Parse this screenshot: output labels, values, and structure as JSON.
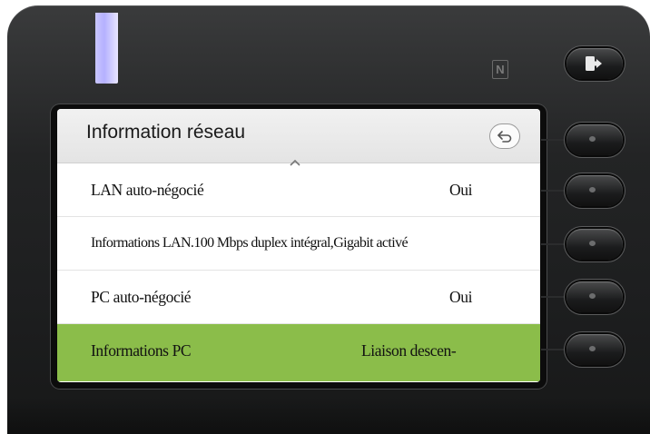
{
  "screen": {
    "title": "Information réseau",
    "rows": [
      {
        "label": "LAN auto-négocié",
        "value": "Oui"
      },
      {
        "label": "Informations LAN.100 Mbps duplex intégral,Gigabit activé",
        "value": ""
      },
      {
        "label": "PC auto-négocié",
        "value": "Oui"
      },
      {
        "label": "Informations PC",
        "value": "Liaison descen-"
      }
    ],
    "selected_row_index": 3
  },
  "icons": {
    "back": "back-arrow-icon",
    "scroll": "scroll-up-icon",
    "nfc": "nfc-icon",
    "exit": "exit-icon"
  },
  "colors": {
    "selection": "#8bbd4a",
    "led": "#b5b1ff",
    "body": "#232425"
  }
}
